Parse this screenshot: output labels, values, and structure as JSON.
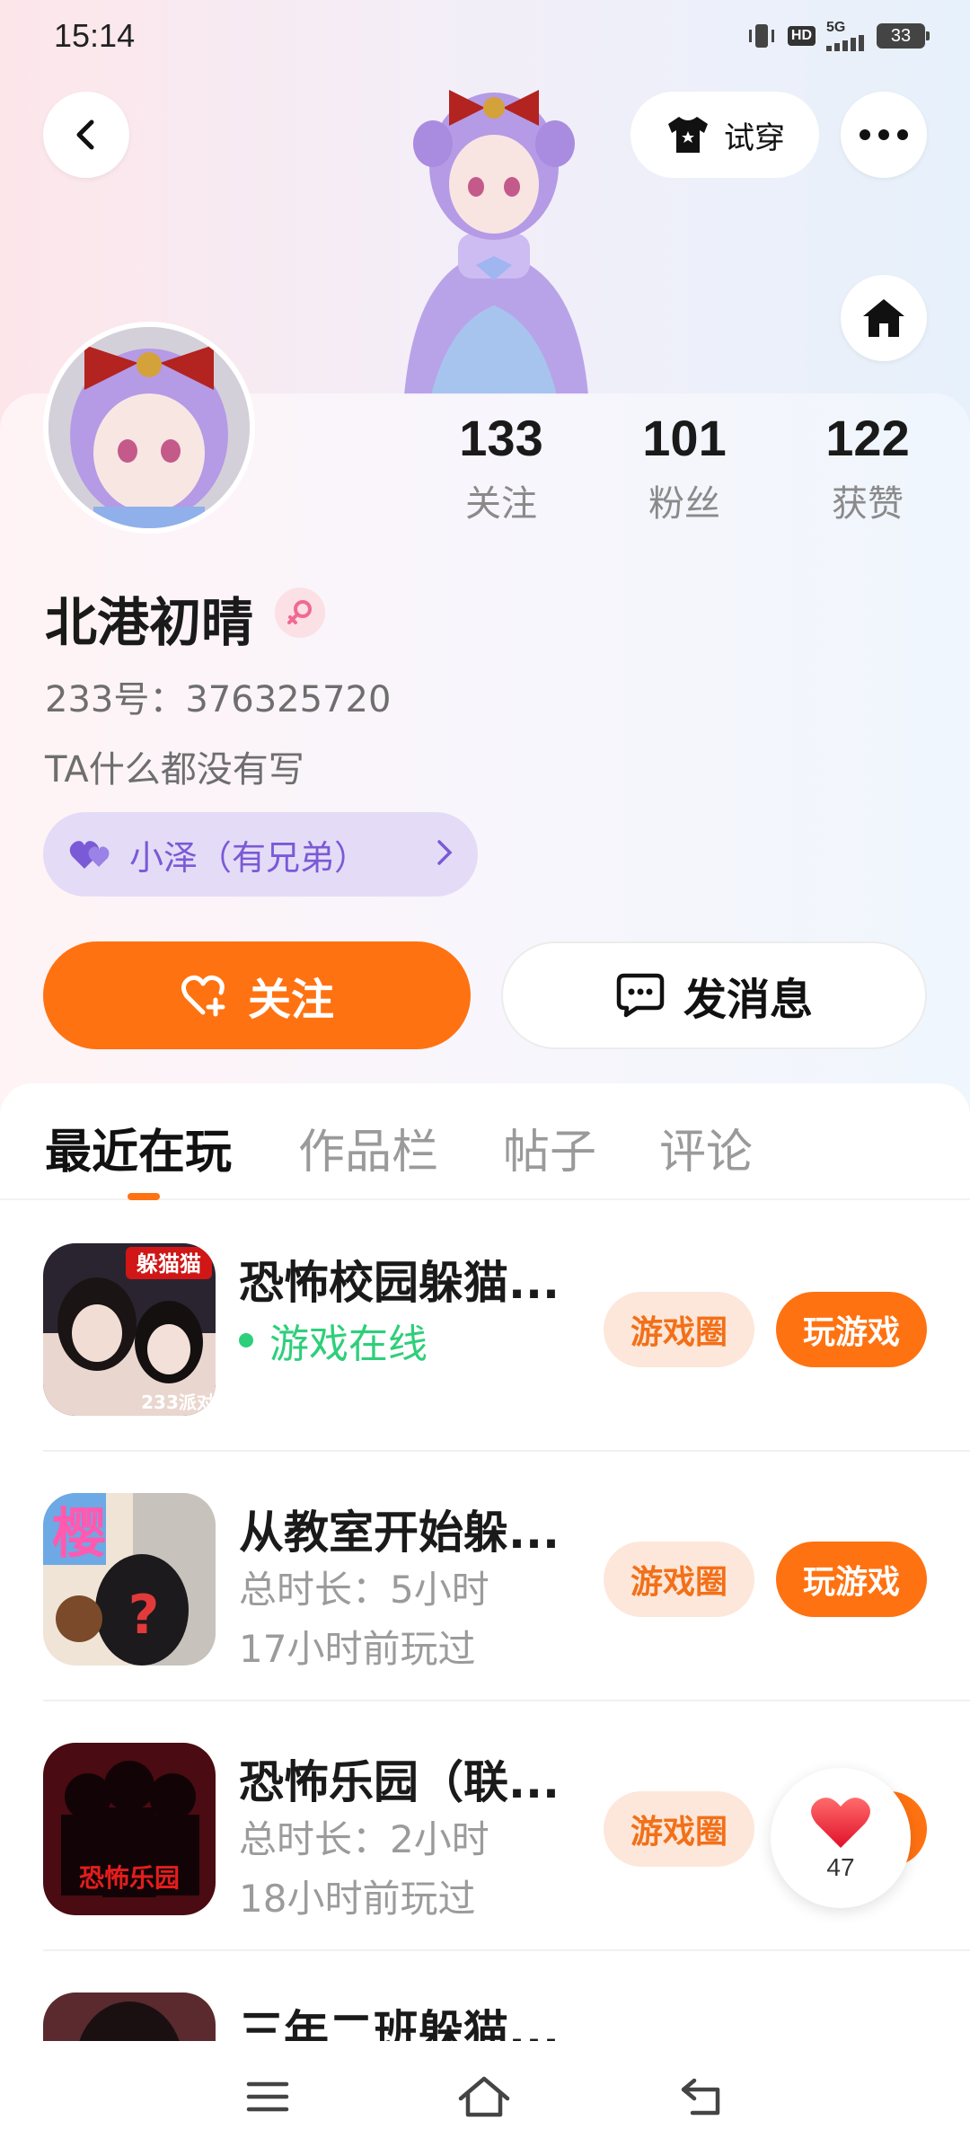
{
  "status_bar": {
    "time": "15:14",
    "hd_label": "HD",
    "network_label": "5G",
    "battery": "33"
  },
  "header": {
    "tryon_label": "试穿"
  },
  "profile": {
    "stats": [
      {
        "value": "133",
        "label": "关注"
      },
      {
        "value": "101",
        "label": "粉丝"
      },
      {
        "value": "122",
        "label": "获赞"
      }
    ],
    "username": "北港初晴",
    "uid": "233号：376325720",
    "bio": "TA什么都没有写",
    "friend_tag": "小泽（有兄弟）"
  },
  "actions": {
    "follow_label": "关注",
    "message_label": "发消息"
  },
  "tabs": [
    {
      "label": "最近在玩",
      "active": true
    },
    {
      "label": "作品栏",
      "active": false
    },
    {
      "label": "帖子",
      "active": false
    },
    {
      "label": "评论",
      "active": false
    }
  ],
  "games": [
    {
      "title": "恐怖校园躲猫...",
      "status": "游戏在线",
      "circle_label": "游戏圈",
      "play_label": "玩游戏",
      "icon_text_top": "躲猫猫",
      "icon_text_bottom": "233派对"
    },
    {
      "title": "从教室开始躲...",
      "duration": "总时长：5小时",
      "last_played": "17小时前玩过",
      "circle_label": "游戏圈",
      "play_label": "玩游戏",
      "icon_text": "樱"
    },
    {
      "title": "恐怖乐园（联...",
      "duration": "总时长：2小时",
      "last_played": "18小时前玩过",
      "circle_label": "游戏圈",
      "icon_text": "恐怖乐园"
    },
    {
      "title": "三年二班躲猫..."
    }
  ],
  "like_float": {
    "count": "47"
  },
  "colors": {
    "accent": "#ff7211",
    "online": "#2ecf7a",
    "friend_tag": "#7a5ad6"
  }
}
